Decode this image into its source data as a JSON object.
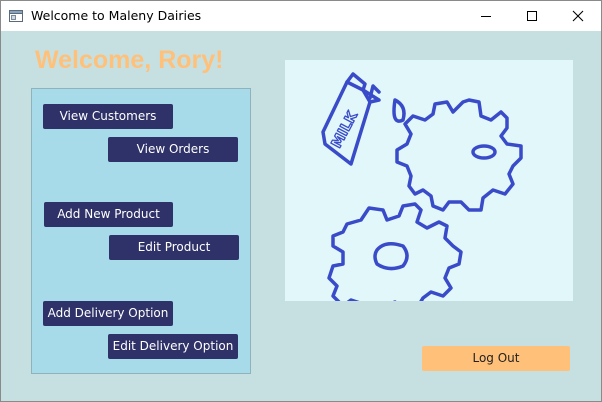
{
  "window": {
    "title": "Welcome to Maleny Dairies"
  },
  "header": {
    "welcome_text": "Welcome, Rory!"
  },
  "menu": {
    "buttons": [
      "View Customers",
      "View Orders",
      "Add New Product",
      "Edit Product",
      "Add Delivery Option",
      "Edit Delivery Option"
    ]
  },
  "logo": {
    "carton_text": "MILK"
  },
  "footer": {
    "logout_label": "Log Out"
  },
  "colors": {
    "background": "#c6e0e1",
    "panel": "#a8dbe9",
    "button": "#2f3268",
    "accent": "#ffc07a",
    "logo_stroke": "#3a4bc9"
  }
}
